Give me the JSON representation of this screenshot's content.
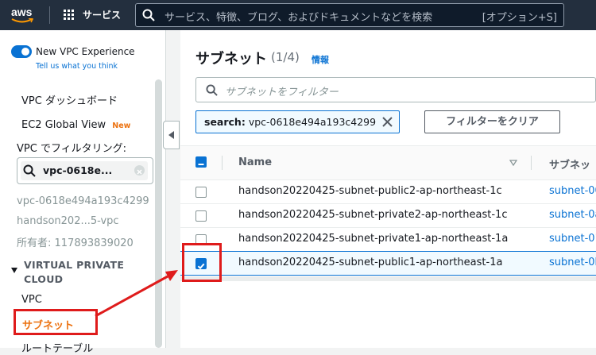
{
  "topbar": {
    "logo_text": "aws",
    "services_label": "サービス",
    "search_placeholder": "サービス、特徴、ブログ、およびドキュメントなどを検索",
    "search_shortcut": "[オプション+S]"
  },
  "sidebar": {
    "toggle_label": "New VPC Experience",
    "toggle_link": "Tell us what you think",
    "items": [
      {
        "label": "VPC ダッシュボード"
      },
      {
        "label": "EC2 Global View",
        "badge": "New"
      }
    ],
    "filter_heading": "VPC でフィルタリング:",
    "filter_value": "vpc-0618e...",
    "vpc_details": [
      "vpc-0618e494a193c4299",
      "handson202...5-vpc",
      "所有者: 117893839020"
    ],
    "section_heading_1": "VIRTUAL PRIVATE",
    "section_heading_2": "CLOUD",
    "nav": [
      {
        "label": "VPC"
      },
      {
        "label": "サブネット",
        "active": true
      },
      {
        "label": "ルートテーブル"
      }
    ]
  },
  "main": {
    "title": "サブネット",
    "count": "(1/4)",
    "info_link": "情報",
    "filter_placeholder": "サブネットをフィルター",
    "token_key": "search:",
    "token_value": "vpc-0618e494a193c4299",
    "clear_button": "フィルターをクリア",
    "columns": [
      "Name",
      "サブネッ"
    ],
    "rows": [
      {
        "name": "handson20220425-subnet-public2-ap-northeast-1c",
        "id": "subnet-00",
        "checked": false
      },
      {
        "name": "handson20220425-subnet-private2-ap-northeast-1c",
        "id": "subnet-0a",
        "checked": false
      },
      {
        "name": "handson20220425-subnet-private1-ap-northeast-1a",
        "id": "subnet-01",
        "checked": false
      },
      {
        "name": "handson20220425-subnet-public1-ap-northeast-1a",
        "id": "subnet-0b",
        "checked": true
      }
    ]
  },
  "colors": {
    "topbar": "#232f3e",
    "accent_blue": "#0972d3",
    "active_nav": "#ec7211",
    "annotation_red": "#df1b1b"
  }
}
